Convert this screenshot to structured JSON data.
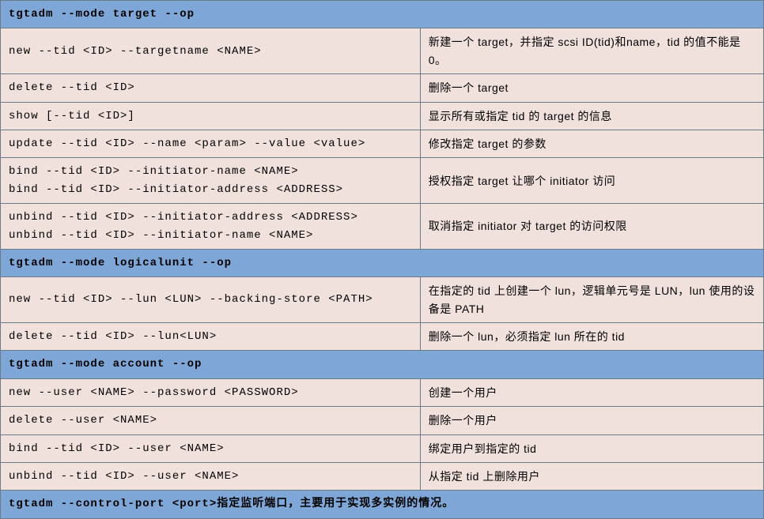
{
  "sections": [
    {
      "header": "tgtadm --mode target --op",
      "rows": [
        {
          "cmd": "new --tid <ID> --targetname <NAME>",
          "desc": "新建一个 target，并指定 scsi ID(tid)和name，tid 的值不能是 0。"
        },
        {
          "cmd": "delete --tid <ID>",
          "desc": "删除一个 target"
        },
        {
          "cmd": "show [--tid <ID>]",
          "desc": "显示所有或指定 tid 的 target 的信息"
        },
        {
          "cmd": "update --tid <ID> --name <param> --value <value>",
          "desc": "修改指定 target 的参数"
        },
        {
          "cmd": "bind --tid <ID> --initiator-name <NAME>\nbind --tid <ID> --initiator-address <ADDRESS>",
          "desc": "授权指定 target 让哪个 initiator 访问"
        },
        {
          "cmd": "unbind --tid <ID> --initiator-address <ADDRESS>\nunbind --tid <ID> --initiator-name <NAME>",
          "desc": "取消指定 initiator 对 target 的访问权限"
        }
      ]
    },
    {
      "header": "tgtadm --mode logicalunit --op",
      "rows": [
        {
          "cmd": "new --tid <ID> --lun <LUN> --backing-store <PATH>",
          "desc": "在指定的 tid 上创建一个 lun，逻辑单元号是 LUN，lun 使用的设备是 PATH"
        },
        {
          "cmd": "delete --tid <ID> --lun<LUN>",
          "desc": "删除一个 lun，必须指定 lun 所在的 tid"
        }
      ]
    },
    {
      "header": "tgtadm --mode account --op",
      "rows": [
        {
          "cmd": "new --user <NAME> --password <PASSWORD>",
          "desc": "创建一个用户"
        },
        {
          "cmd": "delete --user <NAME>",
          "desc": "删除一个用户"
        },
        {
          "cmd": "bind --tid <ID> --user <NAME>",
          "desc": "绑定用户到指定的 tid"
        },
        {
          "cmd": "unbind --tid <ID> --user <NAME>",
          "desc": "从指定 tid 上删除用户"
        }
      ]
    }
  ],
  "footer": {
    "cmd": "tgtadm --control-port <port>",
    "desc": "指定监听端口，主要用于实现多实例的情况。"
  }
}
